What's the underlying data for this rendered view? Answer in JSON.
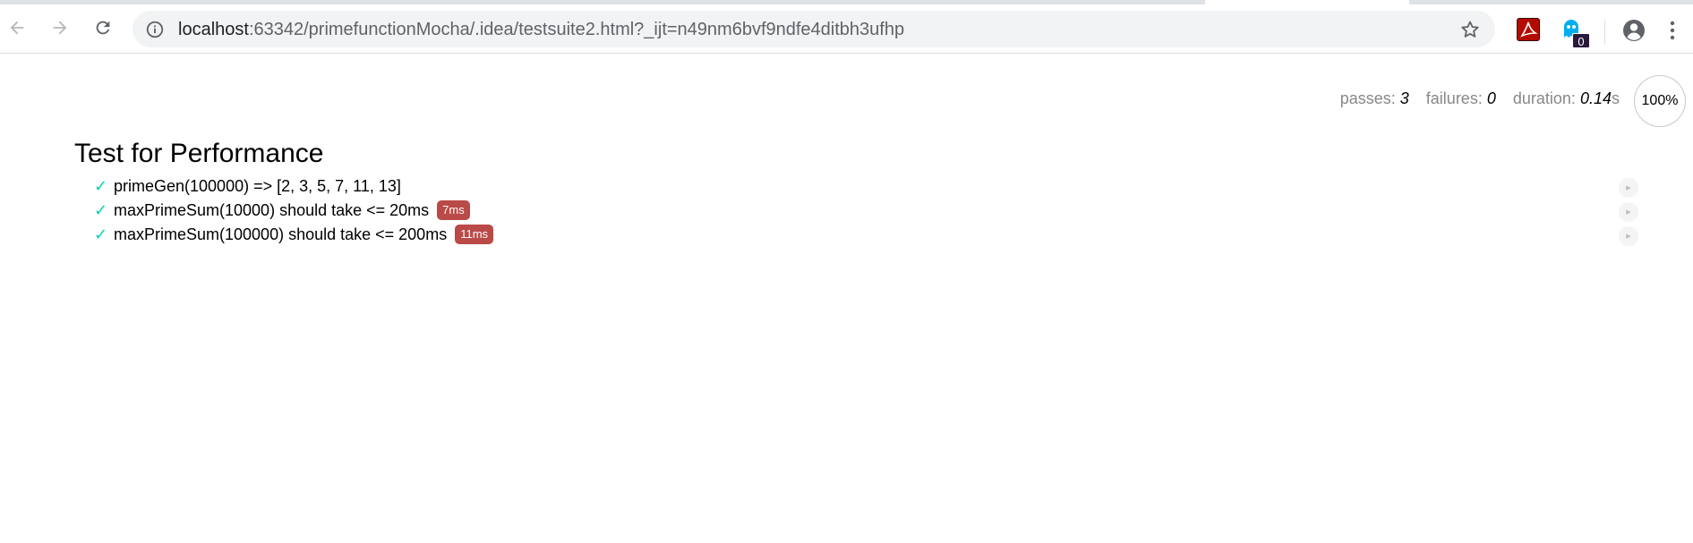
{
  "browser": {
    "url_host": "localhost",
    "url_rest": ":63342/primefunctionMocha/.idea/testsuite2.html?_ijt=n49nm6bvf9ndfe4ditbh3ufhp",
    "extension_badge": "0",
    "colors": {
      "toolbar_bg": "#ffffff",
      "omnibox_bg": "#f1f3f4"
    }
  },
  "stats": {
    "passes_label": "passes:",
    "passes": "3",
    "failures_label": "failures:",
    "failures": "0",
    "duration_label": "duration:",
    "duration": "0.14",
    "duration_unit": "s",
    "progress": "100%"
  },
  "suite": {
    "title": "Test for Performance",
    "tests": [
      {
        "check": "✓",
        "title": "primeGen(100000) => [2, 3, 5, 7, 11, 13]",
        "duration": ""
      },
      {
        "check": "✓",
        "title": "maxPrimeSum(10000) should take <= 20ms",
        "duration": "7ms"
      },
      {
        "check": "✓",
        "title": "maxPrimeSum(100000) should take <= 200ms",
        "duration": "11ms"
      }
    ]
  },
  "colors": {
    "pass_check": "#00d6b2",
    "slow_badge": "#b94a48"
  },
  "icons": [
    "back-icon",
    "forward-icon",
    "reload-icon",
    "info-icon",
    "star-icon",
    "pdf-extension-icon",
    "ghost-extension-icon",
    "profile-icon",
    "menu-icon",
    "replay-icon"
  ]
}
